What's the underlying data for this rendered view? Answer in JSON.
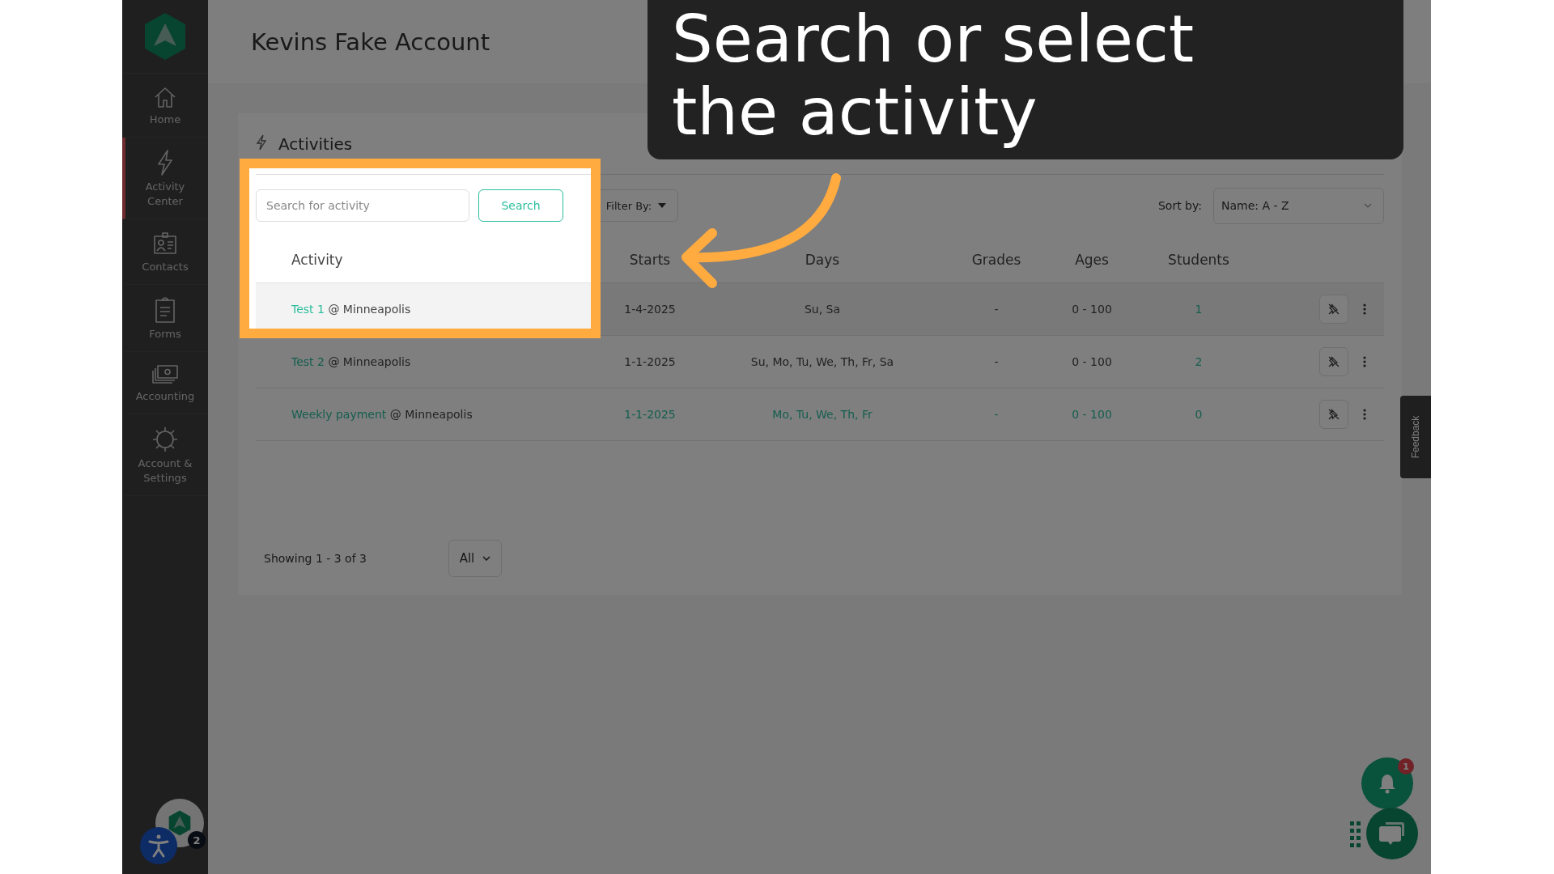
{
  "header": {
    "account_name": "Kevins Fake Account"
  },
  "sidebar": {
    "items": [
      {
        "label": "Home",
        "selected": false
      },
      {
        "label": "Activity Center",
        "selected": true
      },
      {
        "label": "Contacts",
        "selected": false
      },
      {
        "label": "Forms",
        "selected": false
      },
      {
        "label": "Accounting",
        "selected": false
      },
      {
        "label": "Account & Settings",
        "selected": false
      }
    ]
  },
  "caption": {
    "text": "Search or select the activity"
  },
  "activities": {
    "title": "Activities",
    "search": {
      "placeholder": "Search for activity",
      "button": "Search"
    },
    "filter": "Filter By:",
    "sort": {
      "label": "Sort by:",
      "value": "Name: A - Z"
    },
    "columns": [
      "Activity",
      "Starts",
      "Days",
      "Grades",
      "Ages",
      "Students"
    ],
    "rows": [
      {
        "highlighted": true,
        "cells": [
          {
            "name": "Test 1",
            "location": "@ Minneapolis"
          },
          {
            "text": "1-4-2025",
            "link": false
          },
          {
            "text": "Su, Sa",
            "link": false
          },
          {
            "text": "-",
            "link": false
          },
          {
            "text": "0 - 100",
            "link": false
          },
          {
            "text": "1",
            "link": true
          }
        ]
      },
      {
        "highlighted": false,
        "cells": [
          {
            "name": "Test 2",
            "location": "@ Minneapolis"
          },
          {
            "text": "1-1-2025",
            "link": false
          },
          {
            "text": "Su, Mo, Tu, We, Th, Fr, Sa",
            "link": false
          },
          {
            "text": "-",
            "link": false
          },
          {
            "text": "0 - 100",
            "link": false
          },
          {
            "text": "2",
            "link": true
          }
        ]
      },
      {
        "highlighted": false,
        "cells": [
          {
            "name": "Weekly payment",
            "location": "@ Minneapolis"
          },
          {
            "text": "1-1-2025",
            "link": true
          },
          {
            "text": "Mo, Tu, We, Th, Fr",
            "link": true
          },
          {
            "text": "-",
            "link": true
          },
          {
            "text": "0 - 100",
            "link": true
          },
          {
            "text": "0",
            "link": true
          }
        ]
      }
    ],
    "footer": {
      "showing": "Showing 1 - 3 of 3",
      "page_size": "All"
    }
  },
  "feedback": {
    "label": "Feedback"
  },
  "notifications": {
    "count": "1"
  },
  "accessibility": {
    "badge": "2"
  }
}
